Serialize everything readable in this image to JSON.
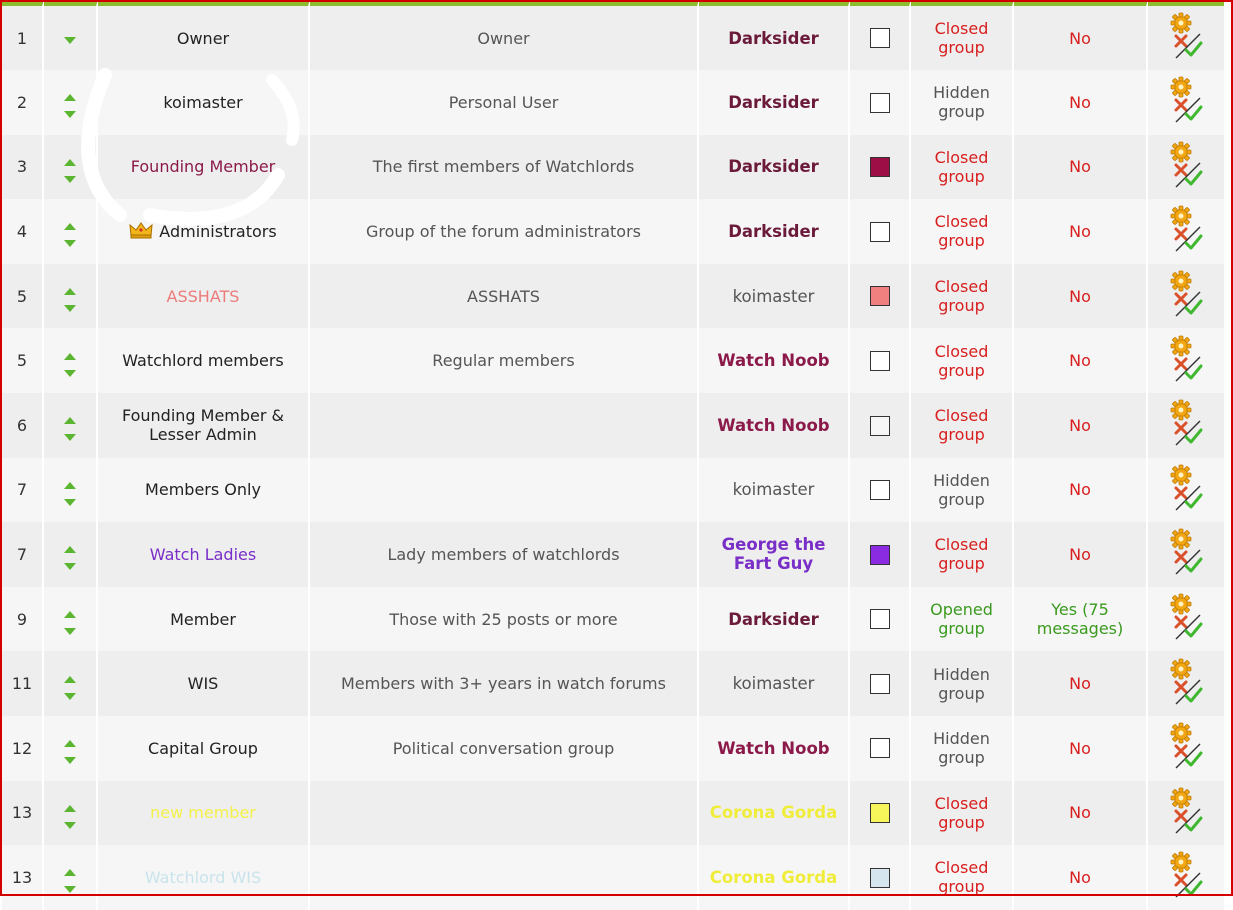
{
  "colors": {
    "header_bar": "#8cbd2f",
    "frame_border": "#d40000",
    "arrow": "#5cb531",
    "status_red": "#d81e1e",
    "status_gray": "#555555",
    "status_green": "#3a9a1e"
  },
  "rows": [
    {
      "pos": "1",
      "name": "Owner",
      "name_color": "#222222",
      "has_up": false,
      "desc": "Owner",
      "leader": "Darksider",
      "leader_color": "#6b1a3a",
      "swatch": "#ffffff",
      "status": "Closed group",
      "status_color": "#d81e1e",
      "msg": "No",
      "msg_color": "#d81e1e"
    },
    {
      "pos": "2",
      "name": "koimaster",
      "name_color": "#222222",
      "desc": "Personal User",
      "leader": "Darksider",
      "leader_color": "#6b1a3a",
      "swatch": "#ffffff",
      "status": "Hidden group",
      "status_color": "#555555",
      "msg": "No",
      "msg_color": "#d81e1e"
    },
    {
      "pos": "3",
      "name": "Founding Member",
      "name_color": "#8b1a4a",
      "desc": "The first members of Watchlords",
      "leader": "Darksider",
      "leader_color": "#6b1a3a",
      "swatch": "#9c0e45",
      "status": "Closed group",
      "status_color": "#d81e1e",
      "msg": "No",
      "msg_color": "#d81e1e"
    },
    {
      "pos": "4",
      "name": "Administrators",
      "name_color": "#222222",
      "has_crown": true,
      "desc": "Group of the forum administrators",
      "leader": "Darksider",
      "leader_color": "#6b1a3a",
      "swatch": "#ffffff",
      "status": "Closed group",
      "status_color": "#d81e1e",
      "msg": "No",
      "msg_color": "#d81e1e"
    },
    {
      "pos": "5",
      "name": "ASSHATS",
      "name_color": "#ec7b7b",
      "desc": "ASSHATS",
      "leader": "koimaster",
      "leader_color": "#555555",
      "leader_plain": true,
      "swatch": "#f08080",
      "status": "Closed group",
      "status_color": "#d81e1e",
      "msg": "No",
      "msg_color": "#d81e1e"
    },
    {
      "pos": "5",
      "name": "Watchlord members",
      "name_color": "#222222",
      "desc": "Regular members",
      "leader": "Watch Noob",
      "leader_color": "#8b1a4a",
      "swatch": "#ffffff",
      "status": "Closed group",
      "status_color": "#d81e1e",
      "msg": "No",
      "msg_color": "#d81e1e"
    },
    {
      "pos": "6",
      "name": "Founding Member & Lesser Admin",
      "name_color": "#222222",
      "desc": "",
      "leader": "Watch Noob",
      "leader_color": "#8b1a4a",
      "swatch": "#f6f6f6",
      "status": "Closed group",
      "status_color": "#d81e1e",
      "msg": "No",
      "msg_color": "#d81e1e"
    },
    {
      "pos": "7",
      "name": "Members Only",
      "name_color": "#222222",
      "desc": "",
      "leader": "koimaster",
      "leader_color": "#555555",
      "leader_plain": true,
      "swatch": "#ffffff",
      "status": "Hidden group",
      "status_color": "#555555",
      "msg": "No",
      "msg_color": "#d81e1e"
    },
    {
      "pos": "7",
      "name": "Watch Ladies",
      "name_color": "#7a2ec8",
      "desc": "Lady members of watchlords",
      "leader": "George the Fart Guy",
      "leader_color": "#7a2ec8",
      "swatch": "#8a2be2",
      "status": "Closed group",
      "status_color": "#d81e1e",
      "msg": "No",
      "msg_color": "#d81e1e"
    },
    {
      "pos": "9",
      "name": "Member",
      "name_color": "#222222",
      "desc": "Those with 25 posts or more",
      "leader": "Darksider",
      "leader_color": "#6b1a3a",
      "swatch": "#ffffff",
      "status": "Opened group",
      "status_color": "#3a9a1e",
      "msg": "Yes (75 messages)",
      "msg_color": "#3a9a1e"
    },
    {
      "pos": "11",
      "name": "WIS",
      "name_color": "#222222",
      "desc": "Members with 3+ years in watch forums",
      "leader": "koimaster",
      "leader_color": "#555555",
      "leader_plain": true,
      "swatch": "#ffffff",
      "status": "Hidden group",
      "status_color": "#555555",
      "msg": "No",
      "msg_color": "#d81e1e"
    },
    {
      "pos": "12",
      "name": "Capital Group",
      "name_color": "#222222",
      "desc": "Political conversation group",
      "leader": "Watch Noob",
      "leader_color": "#8b1a4a",
      "swatch": "#ffffff",
      "status": "Hidden group",
      "status_color": "#555555",
      "msg": "No",
      "msg_color": "#d81e1e"
    },
    {
      "pos": "13",
      "name": "new member",
      "name_color": "#f4f04a",
      "desc": "",
      "leader": "Corona Gorda",
      "leader_color": "#f0ec3a",
      "swatch": "#f6f65a",
      "status": "Closed group",
      "status_color": "#d81e1e",
      "msg": "No",
      "msg_color": "#d81e1e"
    },
    {
      "pos": "13",
      "name": "Watchlord WIS",
      "name_color": "#c9e4ec",
      "desc": "",
      "leader": "Corona Gorda",
      "leader_color": "#f0ec3a",
      "swatch": "#d6e6ee",
      "status": "Closed group",
      "status_color": "#d81e1e",
      "msg": "No",
      "msg_color": "#d81e1e"
    }
  ]
}
